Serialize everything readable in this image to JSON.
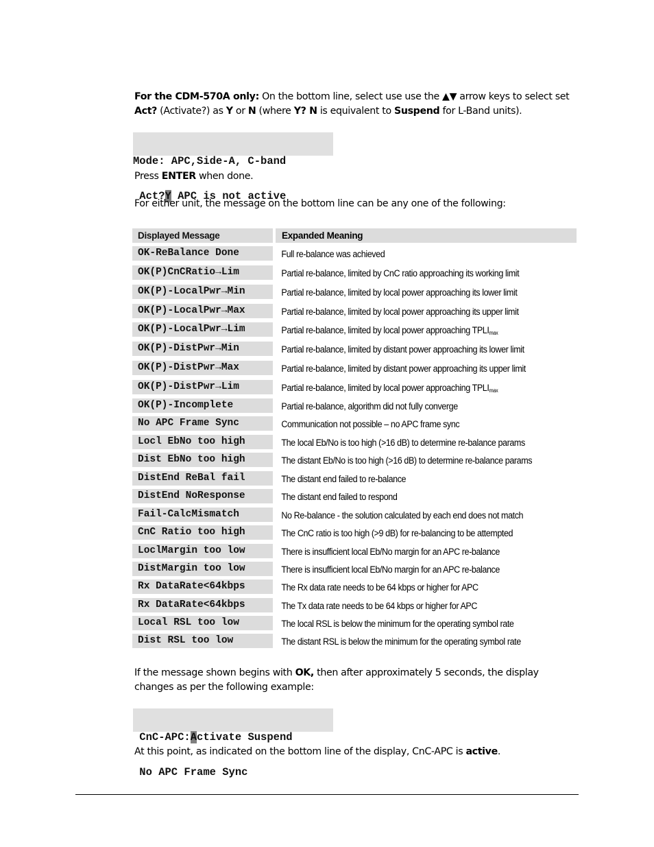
{
  "intro": {
    "line1_bold": "For the CDM-570A only:",
    "line1_rest": " On the bottom line, select use use the ▲▼ arrow keys to select set",
    "line2_b1": "Act?",
    "line2_t1": " (Activate?) as ",
    "line2_b2": "Y",
    "line2_t2": " or ",
    "line2_b3": "N",
    "line2_t3": " (where ",
    "line2_b4": "Y? N",
    "line2_t4": " is equivalent to  ",
    "line2_b5": "Suspend",
    "line2_t5": " for L-Band units)."
  },
  "lcd1": {
    "line1": "Mode: APC,Side-A, C-band",
    "line2_pre": " Act?",
    "line2_cursor": "Y",
    "line2_post": " APC is not active"
  },
  "press_enter": {
    "pre": "Press ",
    "bold": "ENTER",
    "post": " when done."
  },
  "either_unit": "For either unit, the message on the bottom line can be any one of the following:",
  "table": {
    "headers": [
      "Displayed Message",
      "Expanded Meaning"
    ],
    "rows": [
      {
        "msg": "OK-ReBalance Done",
        "meaning": "Full re-balance was achieved"
      },
      {
        "msg": "OK(P)CnCRatio→Lim",
        "meaning": "Partial re-balance, limited by CnC ratio approaching its working limit"
      },
      {
        "msg": "OK(P)-LocalPwr→Min",
        "meaning": "Partial re-balance, limited by local power approaching its lower limit"
      },
      {
        "msg": "OK(P)-LocalPwr→Max",
        "meaning": "Partial re-balance, limited by local power approaching its upper limit"
      },
      {
        "msg": "OK(P)-LocalPwr→Lim",
        "meaning": "Partial re-balance, limited by local power approaching TPLI",
        "sub": "max"
      },
      {
        "msg": "OK(P)-DistPwr→Min",
        "meaning": "Partial re-balance, limited by distant power approaching its lower limit"
      },
      {
        "msg": "OK(P)-DistPwr→Max",
        "meaning": "Partial re-balance, limited by distant power approaching its upper limit"
      },
      {
        "msg": "OK(P)-DistPwr→Lim",
        "meaning": "Partial re-balance, limited by local power approaching TPLI",
        "sub": "max"
      },
      {
        "msg": "OK(P)-Incomplete",
        "meaning": "Partial re-balance, algorithm did not fully converge"
      },
      {
        "msg": "No APC Frame Sync",
        "meaning": "Communication not possible – no APC frame sync"
      },
      {
        "msg": "Locl EbNo too high",
        "meaning": "The local Eb/No is too high (>16 dB) to determine re-balance params"
      },
      {
        "msg": "Dist EbNo too high",
        "meaning": "The distant Eb/No is too high (>16 dB) to determine re-balance params"
      },
      {
        "msg": "DistEnd ReBal fail",
        "meaning": "The distant end failed to re-balance"
      },
      {
        "msg": "DistEnd NoResponse",
        "meaning": "The distant end failed to respond"
      },
      {
        "msg": "Fail-CalcMismatch",
        "meaning": "No Re-balance - the solution calculated by each end does not match"
      },
      {
        "msg": "CnC Ratio too high",
        "meaning": "The CnC ratio is too high (>9 dB) for re-balancing to be attempted"
      },
      {
        "msg": "LoclMargin too low",
        "meaning": "There is insufficient local Eb/No margin for an APC re-balance"
      },
      {
        "msg": "DistMargin too low",
        "meaning": "There is insufficient local Eb/No margin for an APC re-balance"
      },
      {
        "msg": "Rx DataRate<64kbps",
        "meaning": "The Rx data rate needs to be 64 kbps or higher for APC"
      },
      {
        "msg": "Rx DataRate<64kbps",
        "meaning": "The Tx data rate needs to be 64 kbps or higher for APC"
      },
      {
        "msg": "Local RSL too low",
        "meaning": "The local RSL is below the minimum for the operating symbol rate"
      },
      {
        "msg": "Dist RSL too low",
        "meaning": "The distant RSL is below the minimum for the operating symbol rate"
      }
    ]
  },
  "ok_note": {
    "pre": "If the message shown begins with ",
    "bold": "OK,",
    "post": " then after approximately 5 seconds, the display",
    "line2": "changes as per the following example:"
  },
  "lcd2": {
    "line1_pre": " CnC-APC:",
    "line1_cursor": "A",
    "line1_post": "ctivate Suspend",
    "line2": " No APC Frame Sync"
  },
  "closing": {
    "pre": "At this point, as indicated on the bottom line of the display, CnC-APC is ",
    "bold": "active",
    "post": "."
  }
}
